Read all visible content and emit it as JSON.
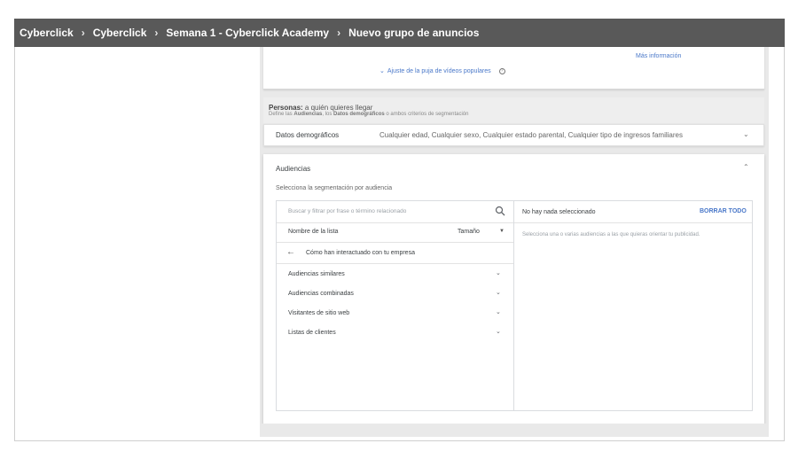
{
  "breadcrumb": [
    {
      "label": "Cyberclick"
    },
    {
      "label": "Cyberclick"
    },
    {
      "label": "Semana 1 - Cyberclick Academy"
    },
    {
      "label": "Nuevo grupo de anuncios"
    }
  ],
  "top_card": {
    "mas_info": "Más información",
    "ajuste": "Ajuste de la puja de vídeos populares"
  },
  "personas": {
    "title_bold": "Personas:",
    "title_rest": " a quién quieres llegar",
    "sub_1": "Define las ",
    "sub_2": "Audiencias",
    "sub_3": ", los ",
    "sub_4": "Datos demográficos",
    "sub_5": " o ambos criterios de segmentación"
  },
  "datos": {
    "label": "Datos demográficos",
    "value": "Cualquier edad, Cualquier sexo, Cualquier estado parental, Cualquier tipo de ingresos familiares"
  },
  "audiencias": {
    "title": "Audiencias",
    "subtitle": "Selecciona la segmentación por audiencia",
    "search_placeholder": "Buscar y filtrar por frase o término relacionado",
    "col_name": "Nombre de la lista",
    "col_size": "Tamaño",
    "back_label": "Cómo han interactuado con tu empresa",
    "items": [
      {
        "label": "Audiencias similares"
      },
      {
        "label": "Audiencias combinadas"
      },
      {
        "label": "Visitantes de sitio web"
      },
      {
        "label": "Listas de clientes"
      }
    ],
    "none_selected": "No hay nada seleccionado",
    "clear_all": "BORRAR TODO",
    "hint": "Selecciona una o varias audiencias a las que quieras orientar tu publicidad."
  },
  "icons": [
    "chevron-right-icon",
    "chevron-down-icon",
    "chevron-up-icon",
    "help-icon",
    "search-icon",
    "arrow-back-icon",
    "caret-down-icon"
  ],
  "colors": {
    "topbar": "#595959",
    "link": "#4a78c9",
    "panel_bg": "#e9e9e9"
  }
}
